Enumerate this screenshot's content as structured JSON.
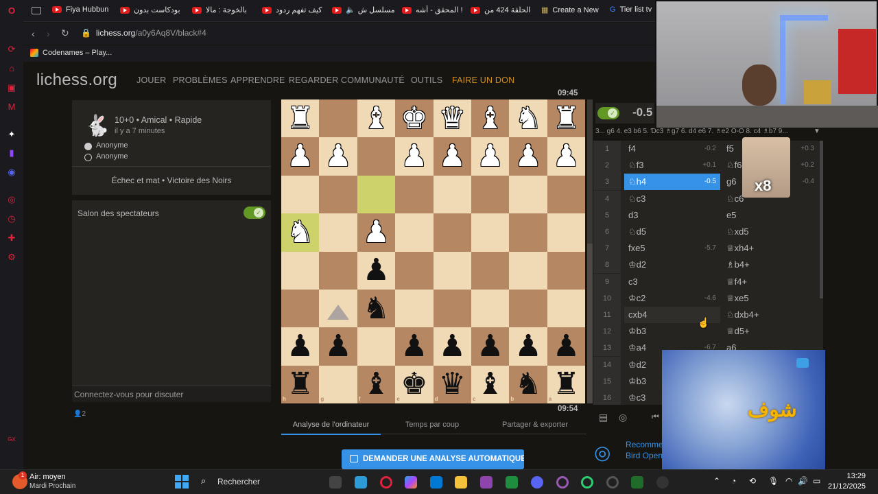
{
  "tabs": [
    {
      "label": "Fiya Hubbun"
    },
    {
      "label": "بودكاست بدون"
    },
    {
      "label": "بالخوجة : مالا"
    },
    {
      "label": "كيف تفهم ردود"
    },
    {
      "label": "مسلسل ش"
    },
    {
      "label": "المحقق - أشه !"
    },
    {
      "label": "الحلقة 424 من"
    },
    {
      "label": "Create a New"
    },
    {
      "label": "Tier list tv"
    }
  ],
  "address": {
    "host": "lichess.org",
    "path": "/a0y6Aq8V/black#4"
  },
  "bookmark": {
    "label": "Codenames – Play..."
  },
  "header": {
    "logo": "lichess.org",
    "nav": [
      "JOUER",
      "PROBLÈMES",
      "APPRENDRE",
      "REGARDER",
      "COMMUNAUTÉ",
      "OUTILS"
    ],
    "donate": "FAIRE UN DON"
  },
  "game": {
    "meta": "10+0 • Amical • Rapide",
    "ago": "il y a 7 minutes",
    "player1": "Anonyme",
    "player2": "Anonyme",
    "result": "Échec et mat • Victoire des Noirs"
  },
  "chat": {
    "title": "Salon des spectateurs",
    "login": "Connectez-vous pour discuter",
    "viewers": "2"
  },
  "clocks": {
    "top": "09:45",
    "bottom": "09:54"
  },
  "eval": {
    "score": "-0.5",
    "pv": "3... g6 4. e3 b6 5. Ɗc3 ♗g7 6. d4 e6 7. ♗e2 O-O 8. c4 ♗b7 9..."
  },
  "moves": [
    {
      "n": "1",
      "w": "f4",
      "we": "-0.2",
      "b": "f5",
      "be": "+0.3"
    },
    {
      "n": "2",
      "w": "♘f3",
      "we": "+0.1",
      "b": "♘f6",
      "be": "+0.2"
    },
    {
      "n": "3",
      "w": "♘h4",
      "we": "-0.5",
      "b": "g6",
      "be": "-0.4"
    },
    {
      "n": "4",
      "w": "♘c3",
      "we": "",
      "b": "♘c6",
      "be": ""
    },
    {
      "n": "5",
      "w": "d3",
      "we": "",
      "b": "e5",
      "be": ""
    },
    {
      "n": "6",
      "w": "♘d5",
      "we": "",
      "b": "♘xd5",
      "be": ""
    },
    {
      "n": "7",
      "w": "fxe5",
      "we": "-5.7",
      "b": "♕xh4+",
      "be": ""
    },
    {
      "n": "8",
      "w": "♔d2",
      "we": "",
      "b": "♗b4+",
      "be": ""
    },
    {
      "n": "9",
      "w": "c3",
      "we": "",
      "b": "♕f4+",
      "be": ""
    },
    {
      "n": "10",
      "w": "♔c2",
      "we": "-4.6",
      "b": "♕xe5",
      "be": ""
    },
    {
      "n": "11",
      "w": "cxb4",
      "we": "",
      "b": "♘dxb4+",
      "be": ""
    },
    {
      "n": "12",
      "w": "♔b3",
      "we": "",
      "b": "♕d5+",
      "be": ""
    },
    {
      "n": "13",
      "w": "♔a4",
      "we": "-6.7",
      "b": "a6",
      "be": ""
    },
    {
      "n": "14",
      "w": "♔d2",
      "we": "",
      "b": "",
      "be": ""
    },
    {
      "n": "15",
      "w": "♔b3",
      "we": "",
      "b": "",
      "be": ""
    },
    {
      "n": "16",
      "w": "♔c3",
      "we": "",
      "b": "",
      "be": ""
    }
  ],
  "underboard": {
    "tabs": [
      "Analyse de l'ordinateur",
      "Temps par coup",
      "Partager & exporter"
    ],
    "analyse_button": "DEMANDER UNE ANALYSE AUTOMATIQUE"
  },
  "opening": {
    "line1": "Recomme",
    "line2": "Bird Open"
  },
  "overlay": {
    "multiplier": "x8",
    "logo_text": "شوف"
  },
  "taskbar": {
    "weather_title": "Air: moyen",
    "weather_sub": "Mardi Prochain",
    "search": "Rechercher",
    "time": "13:29",
    "date": "21/12/2025"
  },
  "colors": {
    "accent": "#3692e7",
    "highlight": "#cdd26a",
    "donate": "#d59120",
    "board_light": "#f0d9b5",
    "board_dark": "#b58863"
  }
}
